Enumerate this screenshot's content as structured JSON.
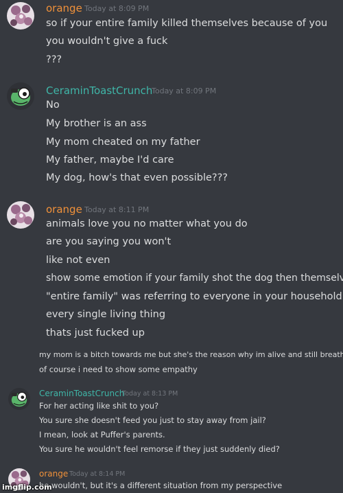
{
  "messages": [
    {
      "author": "orange",
      "time": "Today at 8:09 PM",
      "lines": [
        "so if your entire family killed themselves because of you",
        "you wouldn't give a fuck",
        "???"
      ]
    },
    {
      "author": "CeraminToastCrunch",
      "time": "Today at 8:09 PM",
      "lines": [
        "No",
        "My brother is an ass",
        "My mom cheated on my father",
        "My father, maybe I'd care",
        "My dog, how's that even possible???"
      ]
    },
    {
      "author": "orange",
      "time": "Today at 8:11 PM",
      "lines": [
        "animals love you no matter what you do",
        "are you saying you won't",
        "like not even",
        "show some emotion if your family shot the dog then themselves",
        "\"entire family\" was referring to everyone in your household",
        "every single living thing",
        "thats just fucked up",
        "my mom is a bitch towards me but she's the reason why im alive and still breathing",
        "of course i need to show some empathy"
      ]
    },
    {
      "author": "CeraminToastCrunch",
      "time": "Today at 8:13 PM",
      "lines": [
        "For her acting like shit to you?",
        "You sure she doesn't feed you just to stay away from jail?",
        "I mean, look at Puffer's parents.",
        "You sure he wouldn't feel remorse if they just suddenly died?"
      ]
    },
    {
      "author": "orange",
      "time": "Today at 8:14 PM",
      "lines": [
        "he wouldn't, but it's a different situation from my perspective"
      ]
    }
  ],
  "watermark": "imgflip.com",
  "colors": {
    "background": "#36393f",
    "orange_name": "#f0913a",
    "ceramin_name": "#3fb6a8",
    "text": "#dcddde",
    "timestamp": "#72767d"
  }
}
